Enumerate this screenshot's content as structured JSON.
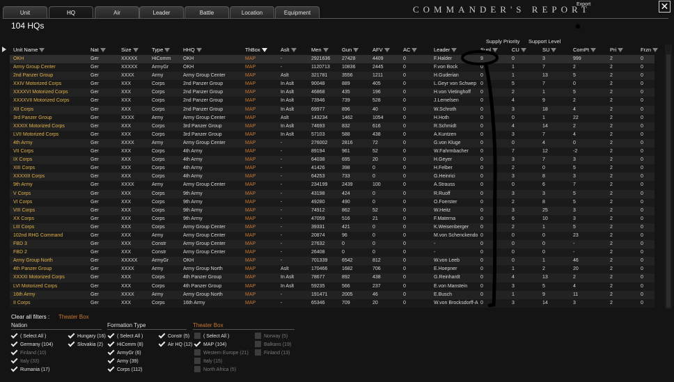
{
  "tabs": [
    "Unit",
    "HQ",
    "Air",
    "Leader",
    "Battle",
    "Location",
    "Equipment"
  ],
  "active_tab": 1,
  "title": "COMMANDER'S REPORT",
  "export_label": "Export",
  "close_symbol": "✕",
  "hq_count": "104 HQs",
  "super_headers": {
    "supply_priority": "Supply Priority",
    "support_level": "Support Level"
  },
  "columns": {
    "unit_name": "Unit Name",
    "nat": "Nat",
    "size": "Size",
    "type": "Type",
    "hhq": "HHQ",
    "thbox": "ThBox",
    "aslt": "Aslt",
    "men": "Men",
    "gun": "Gun",
    "afv": "AFV",
    "ac": "AC",
    "leader": "Leader",
    "supl": "Supl",
    "cu": "CU",
    "su": "SU",
    "compt": "ComPt",
    "pri": "Pri",
    "frzn": "Frzn"
  },
  "rows": [
    [
      "OKH",
      "Ger",
      "XXXXX",
      "HiComm",
      "OKH",
      "MAP",
      "-",
      "2921636",
      "27428",
      "4409",
      "0",
      "F.Halder",
      "9",
      "0",
      "3",
      "999",
      "2",
      "0"
    ],
    [
      "Army Group Center",
      "Ger",
      "XXXXX",
      "ArmyGr",
      "OKH",
      "MAP",
      "-",
      "1120713",
      "10836",
      "2445",
      "0",
      "F.von Bock",
      "0",
      "1",
      "7",
      "2",
      "2",
      "0"
    ],
    [
      "2nd Panzer Group",
      "Ger",
      "XXXX",
      "Army",
      "Army Group Center",
      "MAP",
      "Aslt",
      "321781",
      "3556",
      "1211",
      "0",
      "H.Guderian",
      "0",
      "1",
      "13",
      "5",
      "2",
      "0"
    ],
    [
      "XXIV Motorized Corps",
      "Ger",
      "XXX",
      "Corps",
      "2nd Panzer Group",
      "MAP",
      "In Aslt",
      "90048",
      "889",
      "405",
      "0",
      "L.Geyr von Schwep",
      "0",
      "5",
      "7",
      "0",
      "2",
      "0"
    ],
    [
      "XXXXVI Motorized Corps",
      "Ger",
      "XXX",
      "Corps",
      "2nd Panzer Group",
      "MAP",
      "In Aslt",
      "46868",
      "435",
      "196",
      "0",
      "H.von Vietinghoff",
      "0",
      "2",
      "1",
      "5",
      "2",
      "0"
    ],
    [
      "XXXXVII Motorized Corps",
      "Ger",
      "XXX",
      "Corps",
      "2nd Panzer Group",
      "MAP",
      "In Aslt",
      "73946",
      "739",
      "528",
      "0",
      "J.Lemelsen",
      "0",
      "4",
      "9",
      "2",
      "2",
      "0"
    ],
    [
      "XII Corps",
      "Ger",
      "XXX",
      "Corps",
      "2nd Panzer Group",
      "MAP",
      "In Aslt",
      "69977",
      "896",
      "40",
      "0",
      "W.Schroth",
      "0",
      "3",
      "18",
      "4",
      "2",
      "0"
    ],
    [
      "3rd Panzer Group",
      "Ger",
      "XXXX",
      "Army",
      "Army Group Center",
      "MAP",
      "Aslt",
      "143234",
      "1462",
      "1054",
      "0",
      "H.Hoth",
      "0",
      "0",
      "1",
      "22",
      "2",
      "0"
    ],
    [
      "XXXIX Motorized Corps",
      "Ger",
      "XXX",
      "Corps",
      "3rd Panzer Group",
      "MAP",
      "In Aslt",
      "74693",
      "832",
      "616",
      "0",
      "R.Schmidt",
      "0",
      "4",
      "14",
      "2",
      "2",
      "0"
    ],
    [
      "LVII Motorized Corps",
      "Ger",
      "XXX",
      "Corps",
      "3rd Panzer Group",
      "MAP",
      "In Aslt",
      "57103",
      "588",
      "438",
      "0",
      "A.Kuntzen",
      "0",
      "3",
      "7",
      "4",
      "2",
      "0"
    ],
    [
      "4th Army",
      "Ger",
      "XXXX",
      "Army",
      "Army Group Center",
      "MAP",
      "-",
      "276002",
      "2816",
      "72",
      "0",
      "G.von Kluge",
      "0",
      "0",
      "4",
      "0",
      "2",
      "0"
    ],
    [
      "VII Corps",
      "Ger",
      "XXX",
      "Corps",
      "4th Army",
      "MAP",
      "-",
      "89194",
      "961",
      "52",
      "0",
      "W.Fahrmbacher",
      "0",
      "7",
      "12",
      "-2",
      "2",
      "0"
    ],
    [
      "IX Corps",
      "Ger",
      "XXX",
      "Corps",
      "4th Army",
      "MAP",
      "-",
      "64038",
      "695",
      "20",
      "0",
      "H.Geyer",
      "0",
      "3",
      "7",
      "3",
      "2",
      "0"
    ],
    [
      "XIII Corps",
      "Ger",
      "XXX",
      "Corps",
      "4th Army",
      "MAP",
      "-",
      "41426",
      "398",
      "0",
      "0",
      "H.Felber",
      "0",
      "2",
      "0",
      "5",
      "2",
      "0"
    ],
    [
      "XXXXIII Corps",
      "Ger",
      "XXX",
      "Corps",
      "4th Army",
      "MAP",
      "-",
      "64253",
      "733",
      "0",
      "0",
      "G.Heinrici",
      "0",
      "3",
      "8",
      "3",
      "2",
      "0"
    ],
    [
      "9th Army",
      "Ger",
      "XXXX",
      "Army",
      "Army Group Center",
      "MAP",
      "-",
      "234199",
      "2439",
      "100",
      "0",
      "A.Strauss",
      "0",
      "0",
      "6",
      "7",
      "2",
      "0"
    ],
    [
      "V Corps",
      "Ger",
      "XXX",
      "Corps",
      "9th Army",
      "MAP",
      "-",
      "43198",
      "424",
      "0",
      "0",
      "R.Ruoff",
      "0",
      "3",
      "3",
      "5",
      "2",
      "0"
    ],
    [
      "VI Corps",
      "Ger",
      "XXX",
      "Corps",
      "9th Army",
      "MAP",
      "-",
      "49280",
      "490",
      "0",
      "0",
      "O.Foerster",
      "0",
      "2",
      "8",
      "5",
      "2",
      "0"
    ],
    [
      "VIII Corps",
      "Ger",
      "XXX",
      "Corps",
      "9th Army",
      "MAP",
      "-",
      "74912",
      "862",
      "52",
      "0",
      "W.Heitz",
      "0",
      "3",
      "25",
      "3",
      "2",
      "0"
    ],
    [
      "XX Corps",
      "Ger",
      "XXX",
      "Corps",
      "9th Army",
      "MAP",
      "-",
      "47059",
      "516",
      "21",
      "0",
      "F.Materna",
      "0",
      "6",
      "10",
      "3",
      "2",
      "0"
    ],
    [
      "LIII Corps",
      "Ger",
      "XXX",
      "Corps",
      "Army Group Center",
      "MAP",
      "-",
      "39331",
      "421",
      "0",
      "0",
      "K.Weisenberger",
      "0",
      "2",
      "1",
      "5",
      "2",
      "0"
    ],
    [
      "102nd RHG Command",
      "Ger",
      "XXX",
      "Army",
      "Army Group Center",
      "MAP",
      "-",
      "20874",
      "96",
      "0",
      "0",
      "M.von Schenckendo",
      "0",
      "0",
      "0",
      "23",
      "2",
      "0"
    ],
    [
      "FBD 3",
      "Ger",
      "XXX",
      "Constr",
      "Army Group Center",
      "MAP",
      "-",
      "27632",
      "0",
      "0",
      "0",
      "-",
      "0",
      "0",
      "0",
      "-",
      "2",
      "0"
    ],
    [
      "FBD 2",
      "Ger",
      "XXX",
      "Constr",
      "Army Group Center",
      "MAP",
      "-",
      "26408",
      "0",
      "0",
      "0",
      "-",
      "0",
      "0",
      "0",
      "-",
      "2",
      "0"
    ],
    [
      "Army Group North",
      "Ger",
      "XXXXX",
      "ArmyGr",
      "OKH",
      "MAP",
      "-",
      "701339",
      "6542",
      "812",
      "0",
      "W.von Leeb",
      "0",
      "0",
      "1",
      "46",
      "2",
      "0"
    ],
    [
      "4th Panzer Group",
      "Ger",
      "XXXX",
      "Army",
      "Army Group North",
      "MAP",
      "Aslt",
      "170466",
      "1682",
      "706",
      "0",
      "E.Hoepner",
      "0",
      "1",
      "2",
      "20",
      "2",
      "0"
    ],
    [
      "XXXXI Motorized Corps",
      "Ger",
      "XXX",
      "Corps",
      "4th Panzer Group",
      "MAP",
      "In Aslt",
      "78677",
      "892",
      "438",
      "0",
      "G.Reinhardt",
      "0",
      "4",
      "13",
      "2",
      "2",
      "0"
    ],
    [
      "LVI Motorized Corps",
      "Ger",
      "XXX",
      "Corps",
      "4th Panzer Group",
      "MAP",
      "In Aslt",
      "59235",
      "566",
      "237",
      "0",
      "E.von Manstein",
      "0",
      "3",
      "5",
      "4",
      "2",
      "0"
    ],
    [
      "16th Army",
      "Ger",
      "XXXX",
      "Army",
      "Army Group North",
      "MAP",
      "-",
      "191471",
      "2005",
      "46",
      "0",
      "E.Busch",
      "0",
      "1",
      "9",
      "11",
      "2",
      "0"
    ],
    [
      "II Corps",
      "Ger",
      "XXX",
      "Corps",
      "16th Army",
      "MAP",
      "-",
      "65346",
      "709",
      "20",
      "0",
      "W.von Brocksdorff-A",
      "0",
      "3",
      "14",
      "3",
      "2",
      "0"
    ]
  ],
  "filters": {
    "clear_all": "Clear all filters :",
    "active_tag": "Theater Box",
    "nation": {
      "title": "Nation",
      "items": [
        {
          "label": "( Select All )",
          "checked": true
        },
        {
          "label": "Hungary (16)",
          "checked": true
        },
        {
          "label": "Germany (104)",
          "checked": true
        },
        {
          "label": "Slovakia (2)",
          "checked": true
        },
        {
          "label": "Finland (10)",
          "checked": true,
          "dim": true
        },
        {
          "label": "Italy (33)",
          "checked": true,
          "dim": true
        },
        {
          "label": "Rumania (17)",
          "checked": true
        }
      ]
    },
    "formation": {
      "title": "Formation Type",
      "items": [
        {
          "label": "( Select All )",
          "checked": true
        },
        {
          "label": "Constr (5)",
          "checked": true
        },
        {
          "label": "HiComm (8)",
          "checked": true
        },
        {
          "label": "Air HQ (12)",
          "checked": true
        },
        {
          "label": "ArmyGr (6)",
          "checked": true
        },
        {
          "label": "Army (39)",
          "checked": true
        },
        {
          "label": "Corps (112)",
          "checked": true
        }
      ]
    },
    "theater": {
      "title": "Theater Box",
      "items": [
        {
          "label": "( Select All )",
          "checked": false
        },
        {
          "label": "Norway (5)",
          "checked": false,
          "dim": true
        },
        {
          "label": "MAP (104)",
          "checked": true
        },
        {
          "label": "Balkans (19)",
          "checked": false,
          "dim": true
        },
        {
          "label": "Western Europe (21)",
          "checked": false,
          "dim": true
        },
        {
          "label": "Finland (13)",
          "checked": false,
          "dim": true
        },
        {
          "label": "Italy (15)",
          "checked": false,
          "dim": true
        },
        {
          "label": "North Africa (5)",
          "checked": false,
          "dim": true
        }
      ]
    }
  }
}
